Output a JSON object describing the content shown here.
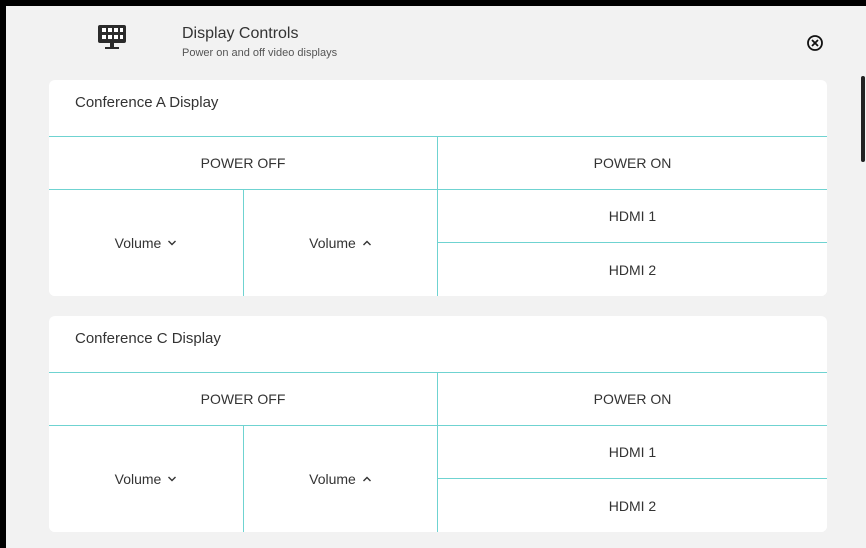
{
  "header": {
    "title": "Display Controls",
    "subtitle": "Power on and off video displays",
    "icon": "display-grid-icon",
    "close_icon": "close-circle-icon"
  },
  "colors": {
    "divider": "#6fd3d1",
    "background": "#f2f2f2",
    "card": "#ffffff"
  },
  "displays": [
    {
      "title": "Conference A Display",
      "power_off": "POWER OFF",
      "power_on": "POWER ON",
      "volume_down": "Volume",
      "volume_up": "Volume",
      "hdmi1": "HDMI 1",
      "hdmi2": "HDMI 2"
    },
    {
      "title": "Conference C Display",
      "power_off": "POWER OFF",
      "power_on": "POWER ON",
      "volume_down": "Volume",
      "volume_up": "Volume",
      "hdmi1": "HDMI 1",
      "hdmi2": "HDMI 2"
    }
  ]
}
